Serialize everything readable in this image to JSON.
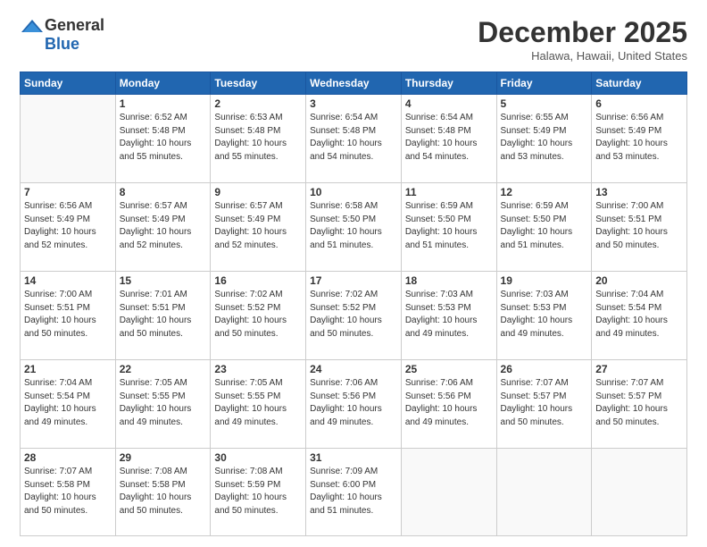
{
  "header": {
    "logo_line1": "General",
    "logo_line2": "Blue",
    "month": "December 2025",
    "location": "Halawa, Hawaii, United States"
  },
  "weekdays": [
    "Sunday",
    "Monday",
    "Tuesday",
    "Wednesday",
    "Thursday",
    "Friday",
    "Saturday"
  ],
  "weeks": [
    [
      {
        "day": "",
        "info": ""
      },
      {
        "day": "1",
        "info": "Sunrise: 6:52 AM\nSunset: 5:48 PM\nDaylight: 10 hours\nand 55 minutes."
      },
      {
        "day": "2",
        "info": "Sunrise: 6:53 AM\nSunset: 5:48 PM\nDaylight: 10 hours\nand 55 minutes."
      },
      {
        "day": "3",
        "info": "Sunrise: 6:54 AM\nSunset: 5:48 PM\nDaylight: 10 hours\nand 54 minutes."
      },
      {
        "day": "4",
        "info": "Sunrise: 6:54 AM\nSunset: 5:48 PM\nDaylight: 10 hours\nand 54 minutes."
      },
      {
        "day": "5",
        "info": "Sunrise: 6:55 AM\nSunset: 5:49 PM\nDaylight: 10 hours\nand 53 minutes."
      },
      {
        "day": "6",
        "info": "Sunrise: 6:56 AM\nSunset: 5:49 PM\nDaylight: 10 hours\nand 53 minutes."
      }
    ],
    [
      {
        "day": "7",
        "info": "Sunrise: 6:56 AM\nSunset: 5:49 PM\nDaylight: 10 hours\nand 52 minutes."
      },
      {
        "day": "8",
        "info": "Sunrise: 6:57 AM\nSunset: 5:49 PM\nDaylight: 10 hours\nand 52 minutes."
      },
      {
        "day": "9",
        "info": "Sunrise: 6:57 AM\nSunset: 5:49 PM\nDaylight: 10 hours\nand 52 minutes."
      },
      {
        "day": "10",
        "info": "Sunrise: 6:58 AM\nSunset: 5:50 PM\nDaylight: 10 hours\nand 51 minutes."
      },
      {
        "day": "11",
        "info": "Sunrise: 6:59 AM\nSunset: 5:50 PM\nDaylight: 10 hours\nand 51 minutes."
      },
      {
        "day": "12",
        "info": "Sunrise: 6:59 AM\nSunset: 5:50 PM\nDaylight: 10 hours\nand 51 minutes."
      },
      {
        "day": "13",
        "info": "Sunrise: 7:00 AM\nSunset: 5:51 PM\nDaylight: 10 hours\nand 50 minutes."
      }
    ],
    [
      {
        "day": "14",
        "info": "Sunrise: 7:00 AM\nSunset: 5:51 PM\nDaylight: 10 hours\nand 50 minutes."
      },
      {
        "day": "15",
        "info": "Sunrise: 7:01 AM\nSunset: 5:51 PM\nDaylight: 10 hours\nand 50 minutes."
      },
      {
        "day": "16",
        "info": "Sunrise: 7:02 AM\nSunset: 5:52 PM\nDaylight: 10 hours\nand 50 minutes."
      },
      {
        "day": "17",
        "info": "Sunrise: 7:02 AM\nSunset: 5:52 PM\nDaylight: 10 hours\nand 50 minutes."
      },
      {
        "day": "18",
        "info": "Sunrise: 7:03 AM\nSunset: 5:53 PM\nDaylight: 10 hours\nand 49 minutes."
      },
      {
        "day": "19",
        "info": "Sunrise: 7:03 AM\nSunset: 5:53 PM\nDaylight: 10 hours\nand 49 minutes."
      },
      {
        "day": "20",
        "info": "Sunrise: 7:04 AM\nSunset: 5:54 PM\nDaylight: 10 hours\nand 49 minutes."
      }
    ],
    [
      {
        "day": "21",
        "info": "Sunrise: 7:04 AM\nSunset: 5:54 PM\nDaylight: 10 hours\nand 49 minutes."
      },
      {
        "day": "22",
        "info": "Sunrise: 7:05 AM\nSunset: 5:55 PM\nDaylight: 10 hours\nand 49 minutes."
      },
      {
        "day": "23",
        "info": "Sunrise: 7:05 AM\nSunset: 5:55 PM\nDaylight: 10 hours\nand 49 minutes."
      },
      {
        "day": "24",
        "info": "Sunrise: 7:06 AM\nSunset: 5:56 PM\nDaylight: 10 hours\nand 49 minutes."
      },
      {
        "day": "25",
        "info": "Sunrise: 7:06 AM\nSunset: 5:56 PM\nDaylight: 10 hours\nand 49 minutes."
      },
      {
        "day": "26",
        "info": "Sunrise: 7:07 AM\nSunset: 5:57 PM\nDaylight: 10 hours\nand 50 minutes."
      },
      {
        "day": "27",
        "info": "Sunrise: 7:07 AM\nSunset: 5:57 PM\nDaylight: 10 hours\nand 50 minutes."
      }
    ],
    [
      {
        "day": "28",
        "info": "Sunrise: 7:07 AM\nSunset: 5:58 PM\nDaylight: 10 hours\nand 50 minutes."
      },
      {
        "day": "29",
        "info": "Sunrise: 7:08 AM\nSunset: 5:58 PM\nDaylight: 10 hours\nand 50 minutes."
      },
      {
        "day": "30",
        "info": "Sunrise: 7:08 AM\nSunset: 5:59 PM\nDaylight: 10 hours\nand 50 minutes."
      },
      {
        "day": "31",
        "info": "Sunrise: 7:09 AM\nSunset: 6:00 PM\nDaylight: 10 hours\nand 51 minutes."
      },
      {
        "day": "",
        "info": ""
      },
      {
        "day": "",
        "info": ""
      },
      {
        "day": "",
        "info": ""
      }
    ]
  ]
}
